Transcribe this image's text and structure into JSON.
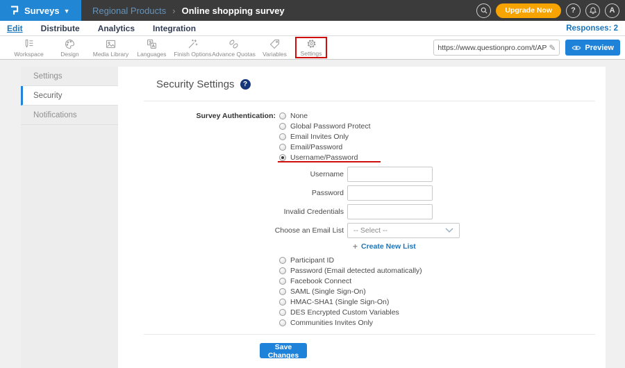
{
  "topbar": {
    "product_menu": "Surveys",
    "breadcrumb": {
      "folder": "Regional Products",
      "separator": "›",
      "title": "Online shopping survey"
    },
    "upgrade_label": "Upgrade Now",
    "help_label": "?",
    "avatar_label": "A"
  },
  "tabbar": {
    "tabs": [
      {
        "label": "Edit"
      },
      {
        "label": "Distribute"
      },
      {
        "label": "Analytics"
      },
      {
        "label": "Integration"
      }
    ],
    "active_tab": "Edit",
    "responses_label": "Responses: 2"
  },
  "toolbar": {
    "items": [
      {
        "icon": "workspace-icon",
        "label": "Workspace"
      },
      {
        "icon": "design-icon",
        "label": "Design"
      },
      {
        "icon": "media-library-icon",
        "label": "Media Library"
      },
      {
        "icon": "languages-icon",
        "label": "Languages"
      },
      {
        "icon": "finish-options-icon",
        "label": "Finish Options"
      },
      {
        "icon": "advance-quotas-icon",
        "label": "Advance Quotas"
      },
      {
        "icon": "variables-icon",
        "label": "Variables"
      },
      {
        "icon": "settings-icon",
        "label": "Settings"
      }
    ],
    "active_item": "Settings",
    "url_value": "https://www.questionpro.com/t/APNrFZ",
    "preview_label": "Preview"
  },
  "sidebar": {
    "items": [
      {
        "label": "Settings",
        "active": false
      },
      {
        "label": "Security",
        "active": true
      },
      {
        "label": "Notifications",
        "active": false
      }
    ]
  },
  "main": {
    "heading": "Security Settings",
    "help_label": "?",
    "auth_section": {
      "label": "Survey Authentication:",
      "options": [
        "None",
        "Global Password Protect",
        "Email Invites Only",
        "Email/Password",
        "Username/Password"
      ],
      "selected": "Username/Password"
    },
    "fields": [
      {
        "label": "Username",
        "value": ""
      },
      {
        "label": "Password",
        "value": ""
      },
      {
        "label": "Invalid Credentials",
        "value": ""
      }
    ],
    "email_list": {
      "label": "Choose an Email List",
      "selected_value": "-- Select --"
    },
    "create_list_plus": "+",
    "create_list_label": "Create New List",
    "extra_options": [
      "Participant ID",
      "Password (Email detected automatically)",
      "Facebook Connect",
      "SAML (Single Sign-On)",
      "HMAC-SHA1 (Single Sign-On)",
      "DES Encrypted Custom Variables",
      "Communities Invites Only"
    ],
    "save_label": "Save Changes"
  },
  "annotations": {
    "highlighted_toolbar_item": "Settings",
    "underlined_option": "Username/Password",
    "annotation_color": "#cf0d0d"
  },
  "colors": {
    "brand_blue": "#2186d3",
    "topbar_dark": "#3b3b3b",
    "orange": "#f7a300",
    "link_blue": "#1a75bb",
    "button_blue": "#1e82d9",
    "help_navy": "#17377a"
  }
}
